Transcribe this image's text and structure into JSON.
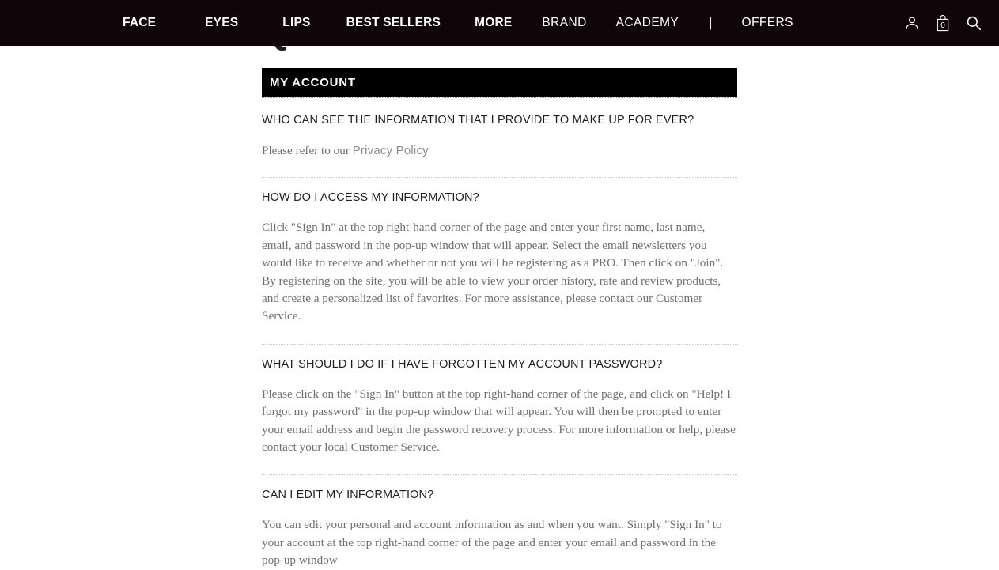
{
  "nav": {
    "items": [
      {
        "label": "FACE",
        "bold": true
      },
      {
        "label": "EYES",
        "bold": true
      },
      {
        "label": "LIPS",
        "bold": true
      },
      {
        "label": "BEST SELLERS",
        "bold": true
      },
      {
        "label": "MORE",
        "bold": true
      },
      {
        "label": "BRAND",
        "bold": false
      },
      {
        "label": "ACADEMY",
        "bold": false
      },
      {
        "label": "OFFERS",
        "bold": false
      }
    ],
    "separator": "|",
    "icons": {
      "account": "account-icon",
      "bag": "shopping-bag-icon",
      "bag_count": "0",
      "search": "search-icon"
    },
    "background": "#100609",
    "text_color": "#ffffff"
  },
  "page": {
    "title": "QUESTIONS",
    "section_title": "MY ACCOUNT",
    "section_bar_color": "#000000"
  },
  "faq": [
    {
      "question": "WHO CAN SEE THE INFORMATION THAT I PROVIDE TO MAKE UP FOR EVER?",
      "answer_before": "Please refer to our ",
      "answer_link": "Privacy Policy",
      "answer_after": ""
    },
    {
      "question": "HOW DO I ACCESS MY INFORMATION?",
      "answer": "Click \"Sign In\" at the top right-hand corner of the page and enter your first name, last name, email, and password in the pop-up window that will appear. Select the email newsletters you would like to receive and whether or not you will be registering as a PRO. Then click on \"Join\". By registering on the site, you will be able to view your order history, rate and review products, and create a personalized list of favorites. For more assistance, please contact our Customer Service."
    },
    {
      "question": "WHAT SHOULD I DO IF I HAVE FORGOTTEN MY ACCOUNT PASSWORD?",
      "answer": "Please click on the \"Sign In\" button at the top right-hand corner of the page, and click on \"Help! I forgot my password\" in the pop-up window that will appear. You will then be prompted to enter your email address and begin the password recovery process. For more information or help, please contact your local Customer Service."
    },
    {
      "question": "CAN I EDIT MY INFORMATION?",
      "answer": "You can edit your personal and account information as and when you want. Simply \"Sign In\" to your account at the top right-hand corner of the page and enter your email and password in the pop-up window"
    }
  ]
}
